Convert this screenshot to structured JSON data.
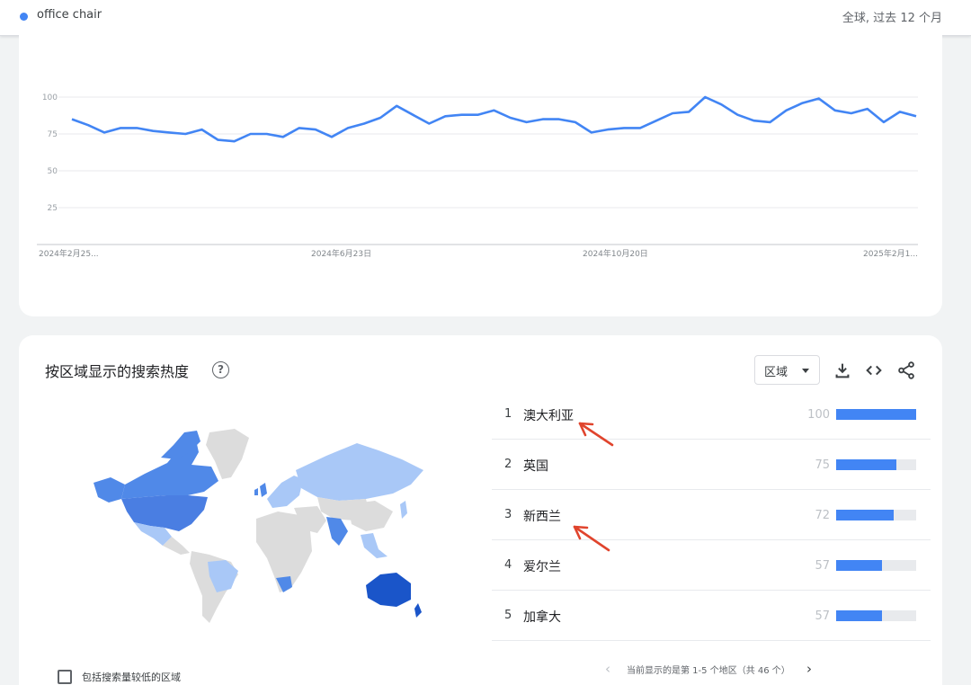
{
  "header": {
    "term": "office chair",
    "scope": "全球, 过去 12 个月"
  },
  "colors": {
    "series": "#4285f4",
    "map_high": "#1a55c9",
    "map_mid": "#5089e8",
    "map_low": "#a9c8f7",
    "map_none": "#dcdcdc",
    "annotation_arrow": "#e0442d"
  },
  "chart_data": {
    "type": "line",
    "series": [
      {
        "values": [
          85,
          81,
          76,
          79,
          79,
          77,
          76,
          75,
          78,
          71,
          70,
          75,
          75,
          73,
          79,
          78,
          73,
          79,
          82,
          86,
          94,
          88,
          82,
          87,
          88,
          88,
          91,
          86,
          83,
          85,
          85,
          83,
          76,
          78,
          79,
          79,
          84,
          89,
          90,
          100,
          95,
          88,
          84,
          83,
          91,
          96,
          99,
          91,
          89,
          92,
          83,
          90,
          87
        ]
      }
    ],
    "x_tick_labels": [
      "2024年2月25...",
      "2024年6月23日",
      "2024年10月20日",
      "2025年2月1..."
    ],
    "y_tick_labels": [
      "100",
      "75",
      "50",
      "25"
    ],
    "ylim": [
      0,
      100
    ],
    "grid": true
  },
  "region": {
    "title": "按区域显示的搜索热度",
    "help_icon": "help-icon",
    "select_value": "区域",
    "tool_icons": [
      "download-icon",
      "embed-icon",
      "share-icon"
    ],
    "items": [
      {
        "rank": "1",
        "name": "澳大利亚",
        "value": "100",
        "bar": 100
      },
      {
        "rank": "2",
        "name": "英国",
        "value": "75",
        "bar": 75
      },
      {
        "rank": "3",
        "name": "新西兰",
        "value": "72",
        "bar": 72
      },
      {
        "rank": "4",
        "name": "爱尔兰",
        "value": "57",
        "bar": 57
      },
      {
        "rank": "5",
        "name": "加拿大",
        "value": "57",
        "bar": 57
      }
    ],
    "pager": {
      "text": "当前显示的是第 1-5 个地区（共 46 个）",
      "prev_icon": "chevron-left-icon",
      "next_icon": "chevron-right-icon"
    },
    "low_volume_label": "包括搜索量较低的区域"
  }
}
